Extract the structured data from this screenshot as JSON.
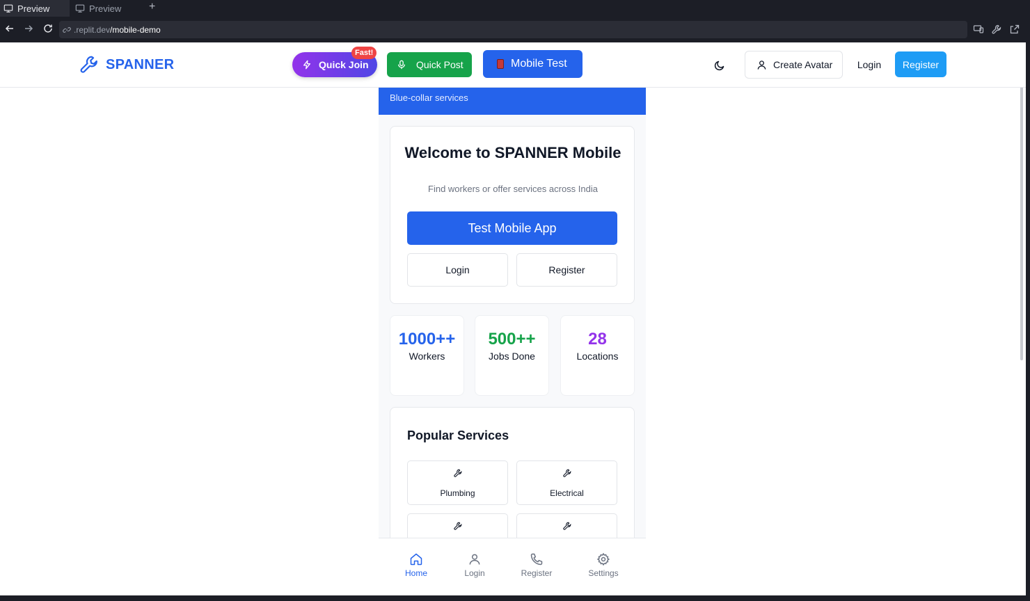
{
  "browser": {
    "tabs": [
      {
        "label": "Preview",
        "active": true
      },
      {
        "label": "Preview",
        "active": false
      }
    ],
    "new_tab": "+",
    "url_prefix": ".replit.dev",
    "url_path": "/mobile-demo"
  },
  "site": {
    "brand": "SPANNER",
    "quick_join": "Quick Join",
    "fast_badge": "Fast!",
    "quick_post": "Quick Post",
    "mobile_test": "Mobile Test",
    "create_avatar": "Create Avatar",
    "login": "Login",
    "register": "Register"
  },
  "mobile": {
    "subtitle": "Blue-collar services",
    "welcome_title": "Welcome to SPANNER Mobile",
    "welcome_sub": "Find workers or offer services across India",
    "test_button": "Test Mobile App",
    "login_button": "Login",
    "register_button": "Register",
    "stats": [
      {
        "value": "1000++",
        "label": "Workers"
      },
      {
        "value": "500++",
        "label": "Jobs Done"
      },
      {
        "value": "28",
        "label": "Locations"
      }
    ],
    "services_title": "Popular Services",
    "services": [
      {
        "label": "Plumbing"
      },
      {
        "label": "Electrical"
      },
      {
        "label": ""
      },
      {
        "label": ""
      }
    ],
    "nav": [
      {
        "label": "Home",
        "icon": "home-icon",
        "active": true
      },
      {
        "label": "Login",
        "icon": "user-icon",
        "active": false
      },
      {
        "label": "Register",
        "icon": "phone-icon",
        "active": false
      },
      {
        "label": "Settings",
        "icon": "gear-icon",
        "active": false
      }
    ]
  },
  "colors": {
    "brand_blue": "#2563eb",
    "green": "#16a34a",
    "purple": "#9333ea",
    "register_blue": "#1e9cf5",
    "badge_red": "#ef4444"
  }
}
